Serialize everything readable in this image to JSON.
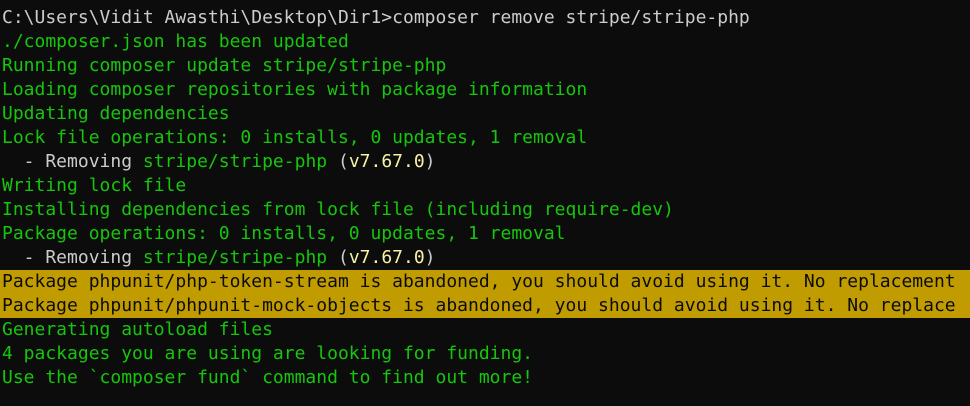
{
  "terminal": {
    "background": "#0c0c0c",
    "colors": {
      "white": "#cccccc",
      "green": "#16c60c",
      "yellow": "#f9f1a5",
      "warning_bg": "#c19c00"
    },
    "prompt": "C:\\Users\\Vidit Awasthi\\Desktop\\Dir1>",
    "command": "composer remove stripe/stripe-php",
    "lines": {
      "l1": "./composer.json has been updated",
      "l2": "Running composer update stripe/stripe-php",
      "l3": "Loading composer repositories with package information",
      "l4": "Updating dependencies",
      "l5": "Lock file operations: 0 installs, 0 updates, 1 removal",
      "l6": {
        "prefix": "  - Removing ",
        "package": "stripe/stripe-php",
        "open": " (",
        "version": "v7.67.0",
        "close": ")"
      },
      "l7": "Writing lock file",
      "l8": "Installing dependencies from lock file (including require-dev)",
      "l9": "Package operations: 0 installs, 0 updates, 1 removal",
      "l10": {
        "prefix": "  - Removing ",
        "package": "stripe/stripe-php",
        "open": " (",
        "version": "v7.67.0",
        "close": ")"
      },
      "warn1": "Package phpunit/php-token-stream is abandoned, you should avoid using it. No replacement",
      "warn2": "Package phpunit/phpunit-mock-objects is abandoned, you should avoid using it. No replace",
      "l13": "Generating autoload files",
      "l14": "4 packages you are using are looking for funding.",
      "l15": "Use the `composer fund` command to find out more!"
    }
  }
}
